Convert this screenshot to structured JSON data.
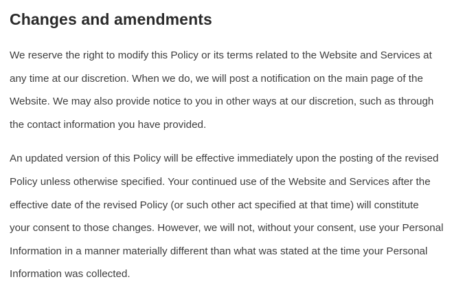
{
  "section": {
    "heading": "Changes and amendments",
    "paragraphs": [
      {
        "lines": [
          "We reserve the right to modify this Policy or its terms related to the Website and Services at",
          "any time at our discretion. When we do, we will post a notification on the main page of the",
          "Website. We may also provide notice to you in other ways at our discretion, such as through",
          "the contact information you have provided."
        ]
      },
      {
        "lines": [
          "An updated version of this Policy will be effective immediately upon the posting of the revised",
          "Policy unless otherwise specified. Your continued use of the Website and Services after the",
          "effective date of the revised Policy (or such other act specified at that time) will constitute",
          "your consent to those changes. However, we will not, without your consent, use your Personal",
          "Information in a manner materially different than what was stated at the time your Personal",
          "Information was collected."
        ]
      }
    ]
  }
}
